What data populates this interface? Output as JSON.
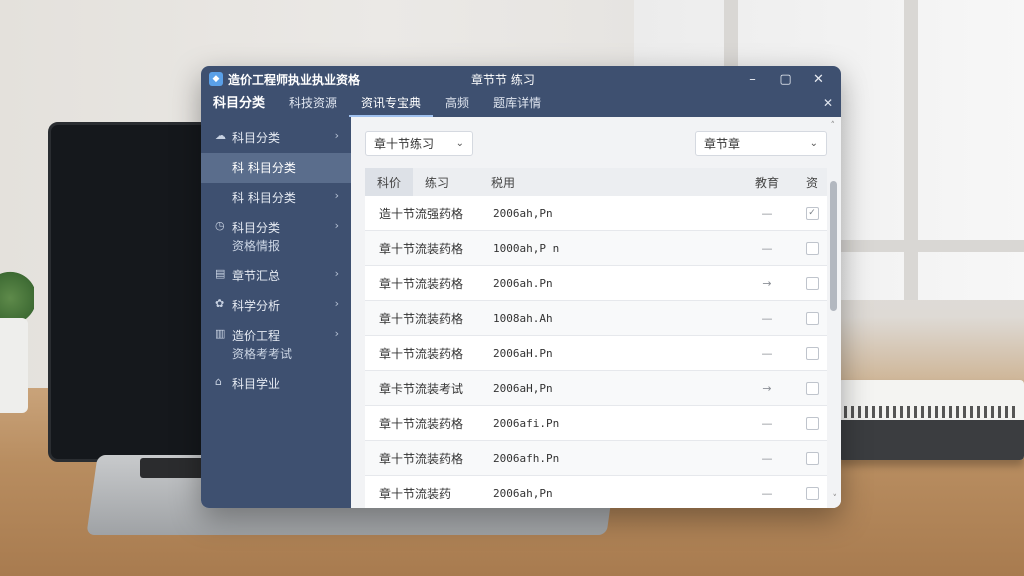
{
  "window": {
    "app_title": "造价工程师执业执业资格",
    "center_title": "章节节 练习",
    "controls": {
      "minimize": "–",
      "maximize": "▢",
      "close": "✕"
    }
  },
  "menubar": {
    "items": [
      "科目分类",
      "科技资源",
      "资讯专宝典",
      "高频",
      "题库详情"
    ],
    "active_index": 2,
    "close": "✕"
  },
  "sidebar": {
    "items": [
      {
        "icon": "cloud-icon",
        "glyph": "☁",
        "label": "科目分类",
        "sub": "",
        "chevron": "›"
      },
      {
        "icon": "",
        "glyph": "",
        "label": "科 科目分类",
        "sub": "",
        "chevron": ""
      },
      {
        "icon": "",
        "glyph": "",
        "label": "科 科目分类",
        "sub": "",
        "chevron": "›"
      },
      {
        "icon": "clock-icon",
        "glyph": "◷",
        "label": "科目分类",
        "sub": "资格情报",
        "chevron": "›"
      },
      {
        "icon": "book-icon",
        "glyph": "▤",
        "label": "章节汇总",
        "sub": "",
        "chevron": "›"
      },
      {
        "icon": "analysis-icon",
        "glyph": "✿",
        "label": "科学分析",
        "sub": "",
        "chevron": "›"
      },
      {
        "icon": "building-icon",
        "glyph": "▥",
        "label": "造价工程",
        "sub": "资格考考试",
        "chevron": "›"
      },
      {
        "icon": "bank-icon",
        "glyph": "⌂",
        "label": "科目学业",
        "sub": "",
        "chevron": ""
      }
    ],
    "active_index": 1
  },
  "toolbar": {
    "left_select": "章十节练习",
    "right_select": "章节章",
    "chevron": "⌄"
  },
  "table": {
    "tabs": [
      "科价",
      "练习"
    ],
    "selected_tab": 0,
    "col3": "税用",
    "col4": "教育",
    "col5": "资",
    "rows": [
      {
        "name": "造十节流强药格",
        "value": "2006ah,Pn",
        "arrow": "—",
        "check": "✓"
      },
      {
        "name": "章十节流装药格",
        "value": "1000ah,P n",
        "arrow": "—",
        "check": ""
      },
      {
        "name": "章十节流装药格",
        "value": "2006ah.Pn",
        "arrow": "→",
        "check": ""
      },
      {
        "name": "章十节流装药格",
        "value": "1008ah.Ah",
        "arrow": "—",
        "check": ""
      },
      {
        "name": "章十节流装药格",
        "value": "2006aH.Pn",
        "arrow": "—",
        "check": ""
      },
      {
        "name": "章卡节流装考试",
        "value": "2006aH,Pn",
        "arrow": "→",
        "check": ""
      },
      {
        "name": "章十节流装药格",
        "value": "2006afi.Pn",
        "arrow": "—",
        "check": ""
      },
      {
        "name": "章十节流装药格",
        "value": "2006afh.Pn",
        "arrow": "—",
        "check": ""
      },
      {
        "name": "章十节流装药",
        "value": "2006ah,Pn",
        "arrow": "—",
        "check": ""
      }
    ]
  },
  "scroll": {
    "up": "˄",
    "down": "˅"
  }
}
